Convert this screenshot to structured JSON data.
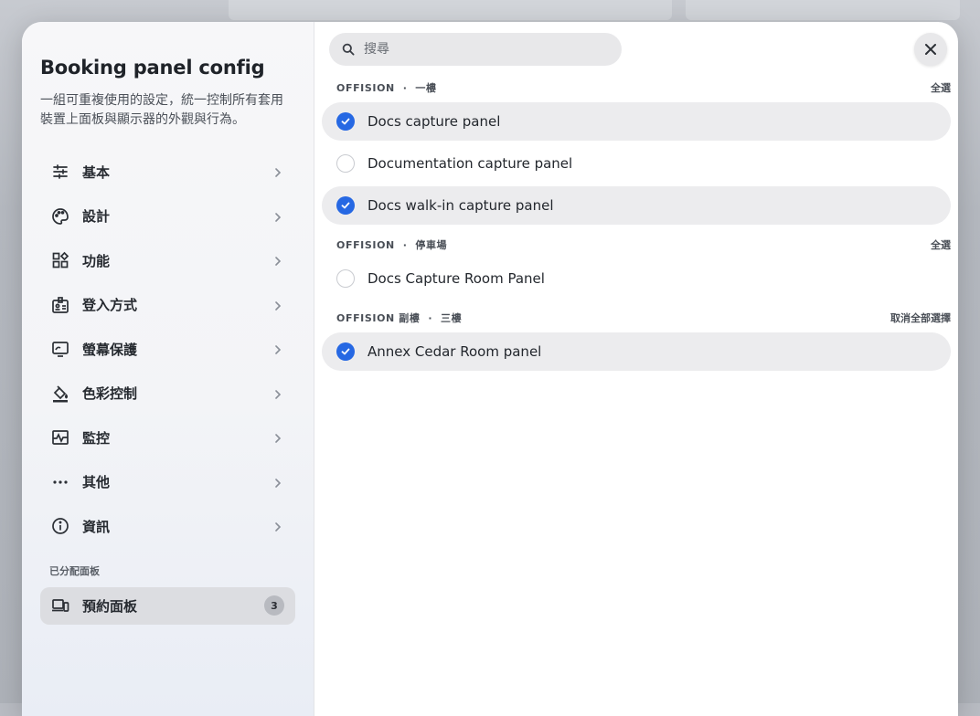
{
  "sidebar": {
    "title": "Booking panel config",
    "description": "一組可重複使用的設定，統一控制所有套用裝置上面板與顯示器的外觀與行為。",
    "items": [
      {
        "label": "基本",
        "icon": "sliders-icon"
      },
      {
        "label": "設計",
        "icon": "palette-icon"
      },
      {
        "label": "功能",
        "icon": "widgets-icon"
      },
      {
        "label": "登入方式",
        "icon": "badge-icon"
      },
      {
        "label": "螢幕保護",
        "icon": "screen-icon"
      },
      {
        "label": "色彩控制",
        "icon": "paint-bucket-icon"
      },
      {
        "label": "監控",
        "icon": "monitoring-icon"
      },
      {
        "label": "其他",
        "icon": "more-icon"
      },
      {
        "label": "資訊",
        "icon": "info-icon"
      }
    ],
    "assigned_section_label": "已分配面板",
    "assigned": {
      "label": "預約面板",
      "count": "3",
      "icon": "devices-icon"
    }
  },
  "search": {
    "placeholder": "搜尋",
    "value": ""
  },
  "groups": [
    {
      "location": "OFFISION",
      "floor": "一樓",
      "action": "全選",
      "rows": [
        {
          "label": "Docs capture panel",
          "selected": true
        },
        {
          "label": "Documentation capture panel",
          "selected": false
        },
        {
          "label": "Docs walk-in capture panel",
          "selected": true
        }
      ]
    },
    {
      "location": "OFFISION",
      "floor": "停車場",
      "action": "全選",
      "rows": [
        {
          "label": "Docs Capture Room Panel",
          "selected": false
        }
      ]
    },
    {
      "location": "OFFISION 副樓",
      "floor": "三樓",
      "action": "取消全部選擇",
      "rows": [
        {
          "label": "Annex Cedar Room panel",
          "selected": true
        }
      ]
    }
  ],
  "colors": {
    "accent": "#2668e3"
  }
}
